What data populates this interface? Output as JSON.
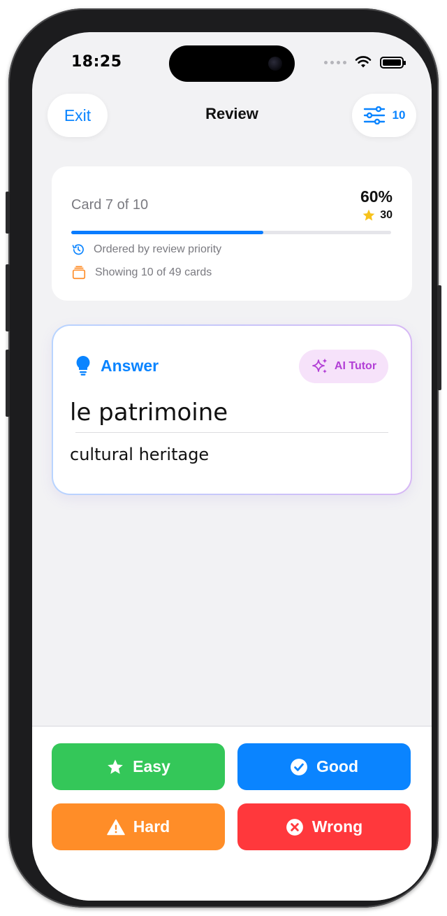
{
  "status_bar": {
    "time": "18:25"
  },
  "nav": {
    "exit_label": "Exit",
    "title": "Review",
    "filter_count": "10"
  },
  "progress": {
    "card_position": "Card 7 of 10",
    "percent_label": "60%",
    "percent_value": 0.6,
    "stars": "30",
    "order_note": "Ordered by review priority",
    "showing_note": "Showing 10 of 49 cards"
  },
  "answer_card": {
    "label": "Answer",
    "tutor_label": "AI Tutor",
    "term": "le patrimoine",
    "definition": "cultural heritage"
  },
  "grading": {
    "easy": "Easy",
    "good": "Good",
    "hard": "Hard",
    "wrong": "Wrong"
  },
  "colors": {
    "accent": "#0a84ff",
    "easy": "#34c759",
    "good": "#0a84ff",
    "hard": "#ff8d28",
    "wrong": "#ff383c",
    "tutor": "#b23fd6",
    "star": "#f7c21b"
  },
  "icons": {
    "filter": "sliders-icon",
    "star": "star-icon",
    "order": "clock-history-icon",
    "showing": "card-stack-icon",
    "answer": "lightbulb-icon",
    "tutor": "sparkles-icon",
    "easy": "star-icon",
    "good": "checkmark-circle-icon",
    "hard": "warning-triangle-icon",
    "wrong": "x-circle-icon"
  }
}
